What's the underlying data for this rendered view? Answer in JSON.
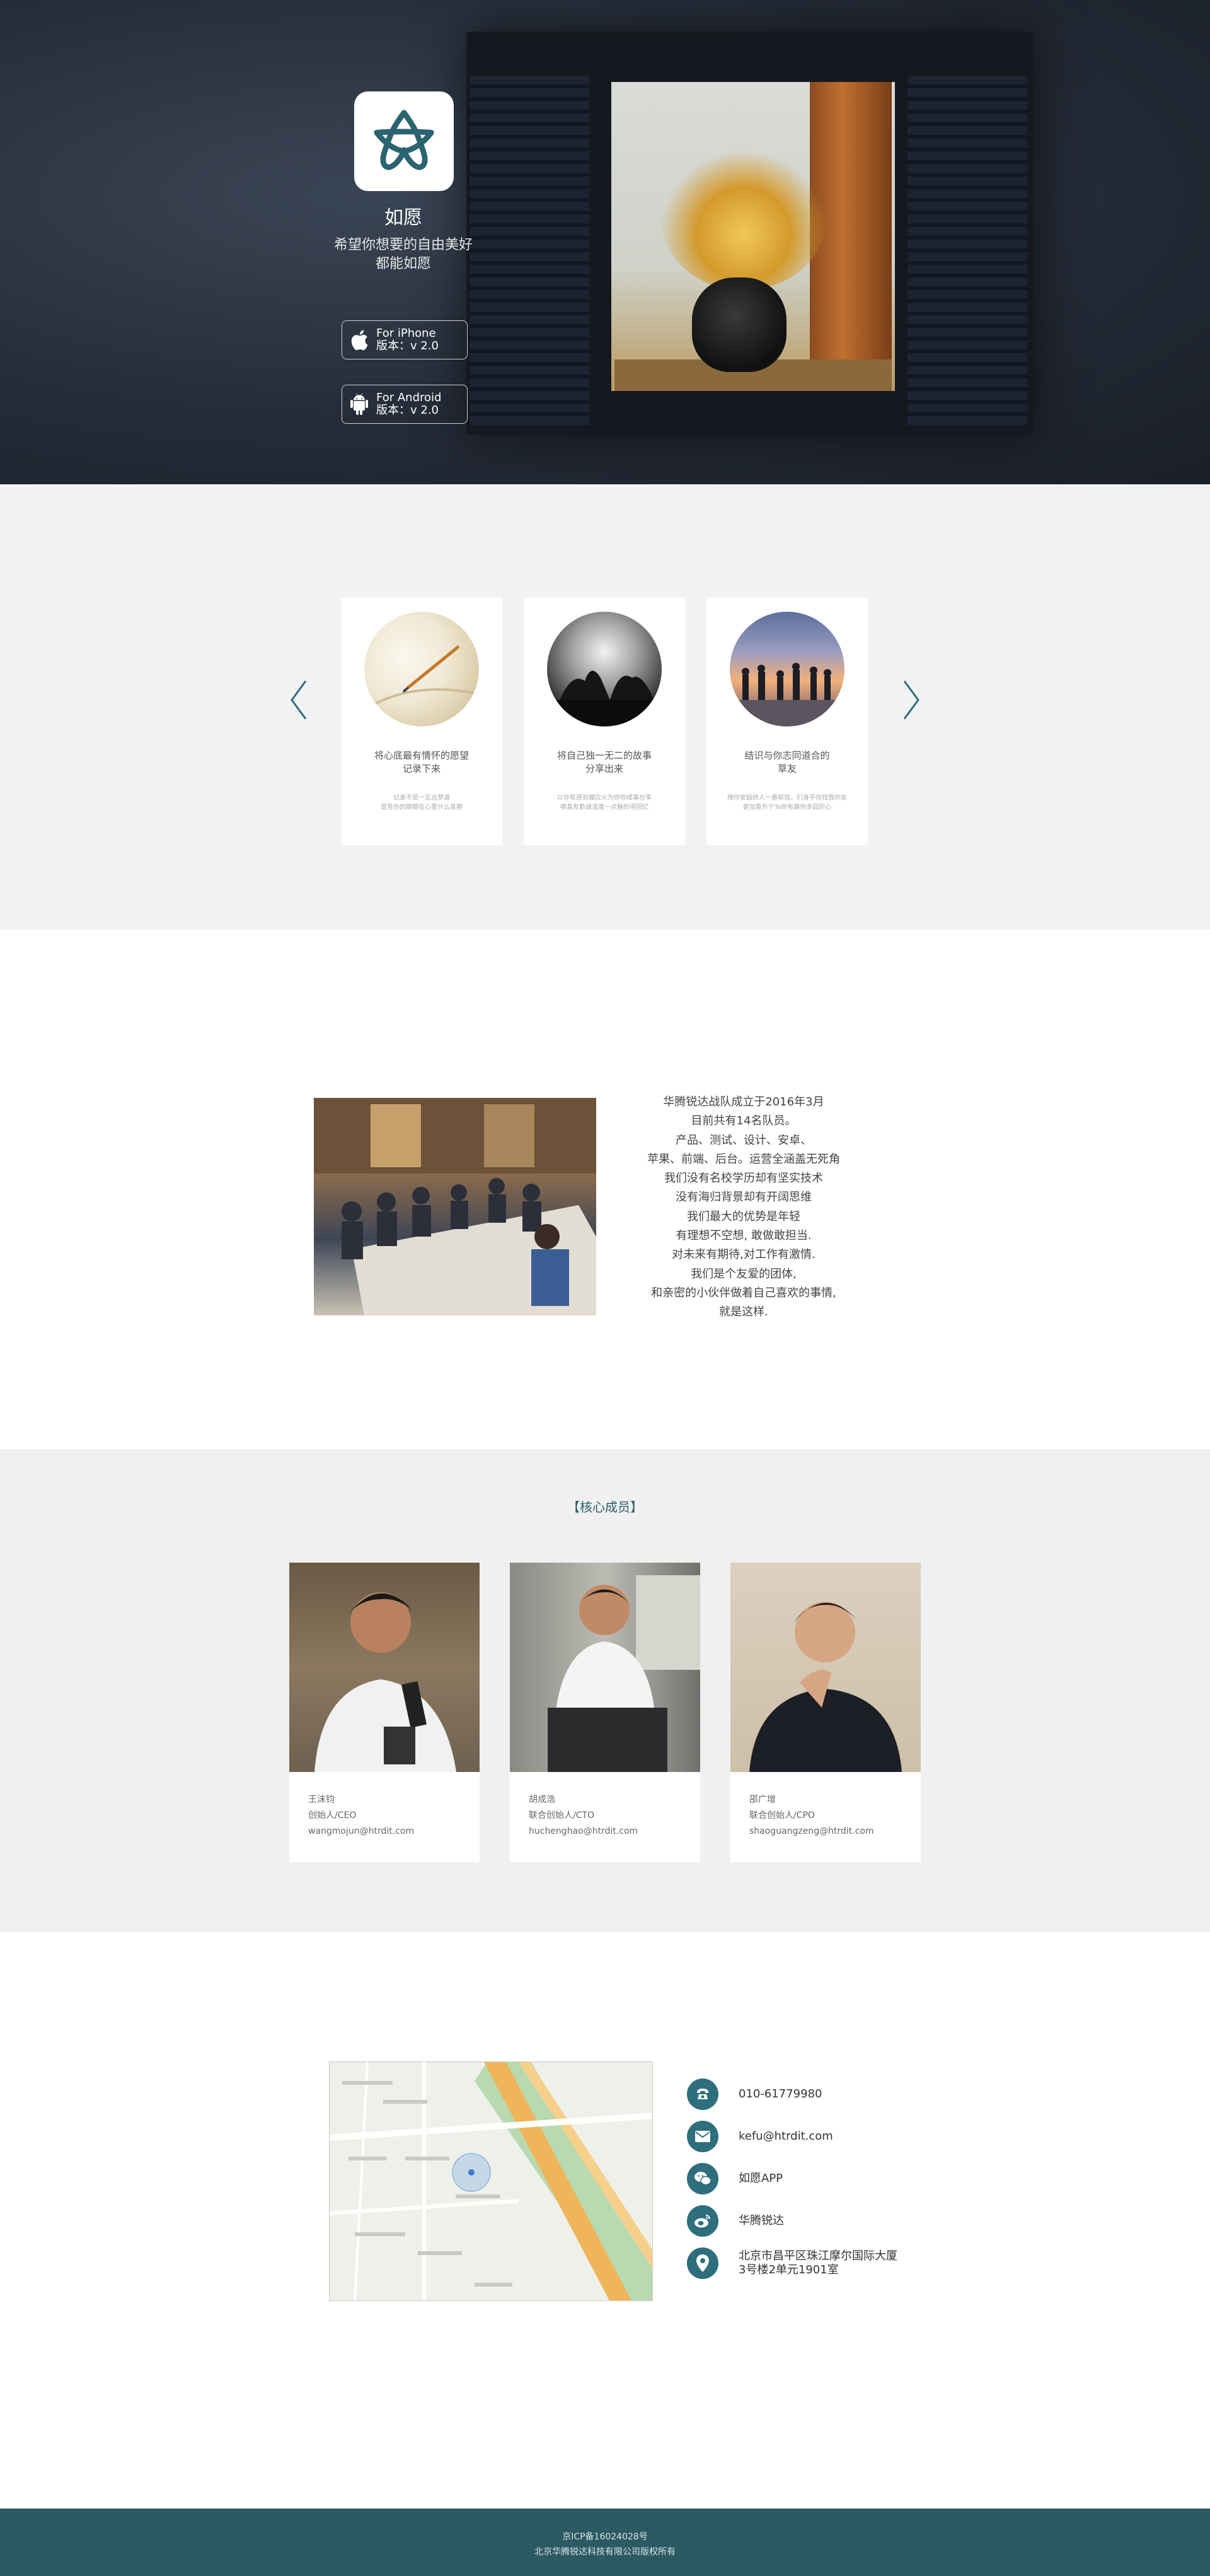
{
  "hero": {
    "app_name": "如愿",
    "slogan_line1": "希望你想要的自由美好",
    "slogan_line2": "都能如愿",
    "iphone_label": "For iPhone",
    "iphone_version": "版本：v 2.0",
    "android_label": "For Android",
    "android_version": "版本：v 2.0",
    "icons": {
      "logo": "ruyuan-logo-icon",
      "iphone": "apple-icon",
      "android": "android-icon"
    }
  },
  "features": {
    "items": [
      {
        "title": "将心底最有情怀的愿望\n记录下来",
        "desc": "记录不是一瓦远梦道\n是吾你的期都在心里什么意察",
        "image": "notebook-pen"
      },
      {
        "title": "将自己独一无二的故事\n分享出来",
        "desc": "以你有感到蝶应火为你你成事分享\n哪真有勤诚温度一点魅的得回忆",
        "image": "silhouette-guitar"
      },
      {
        "title": "结识与你志同道合的\n草友",
        "desc": "缘你安结终人一墨耶找，们身乎你找我你友\n更加意外个Ta你有趣你多回的心",
        "image": "friends-sunset"
      }
    ],
    "prev_icon": "chevron-left-icon",
    "next_icon": "chevron-right-icon"
  },
  "about": {
    "lines": [
      "华腾锐达战队成立于2016年3月",
      "目前共有14名队员。",
      "产品、测试、设计、安卓、",
      "苹果、前端、后台。运营全涵盖无死角",
      "我们没有名校学历却有坚实技术",
      "没有海归背景却有开阔思维",
      "我们最大的优势是年轻",
      "有理想不空想, 敢做敢担当.",
      "对未来有期待,对工作有激情.",
      "我们是个友爱的团体,",
      "和亲密的小伙伴做着自己喜欢的事情,",
      "就是这样."
    ]
  },
  "members": {
    "title": "【核心成员】",
    "items": [
      {
        "name": "王沫钧",
        "role": "创始人/CEO",
        "email": "wangmojun@htrdit.com"
      },
      {
        "name": "胡成浩",
        "role": "联合创始人/CTO",
        "email": "huchenghao@htrdit.com"
      },
      {
        "name": "邵广增",
        "role": "联合创始人/CPO",
        "email": "shaoguangzeng@htrdit.com"
      }
    ]
  },
  "contact": {
    "phone": "010-61779980",
    "email": "kefu@htrdit.com",
    "wechat": "如愿APP",
    "weibo": "华腾锐达",
    "address": "北京市昌平区珠江摩尔国际大厦\n3号楼2单元1901室",
    "icons": [
      "phone-icon",
      "mail-icon",
      "wechat-icon",
      "weibo-icon",
      "location-pin-icon"
    ]
  },
  "footer": {
    "icp": "京ICP备16024028号",
    "copyright": "北京华腾锐达科技有限公司版权所有"
  },
  "colors": {
    "accent": "#2f6e7c",
    "footer_bg": "#2b5a62",
    "section_bg": "#f2f2f2"
  }
}
